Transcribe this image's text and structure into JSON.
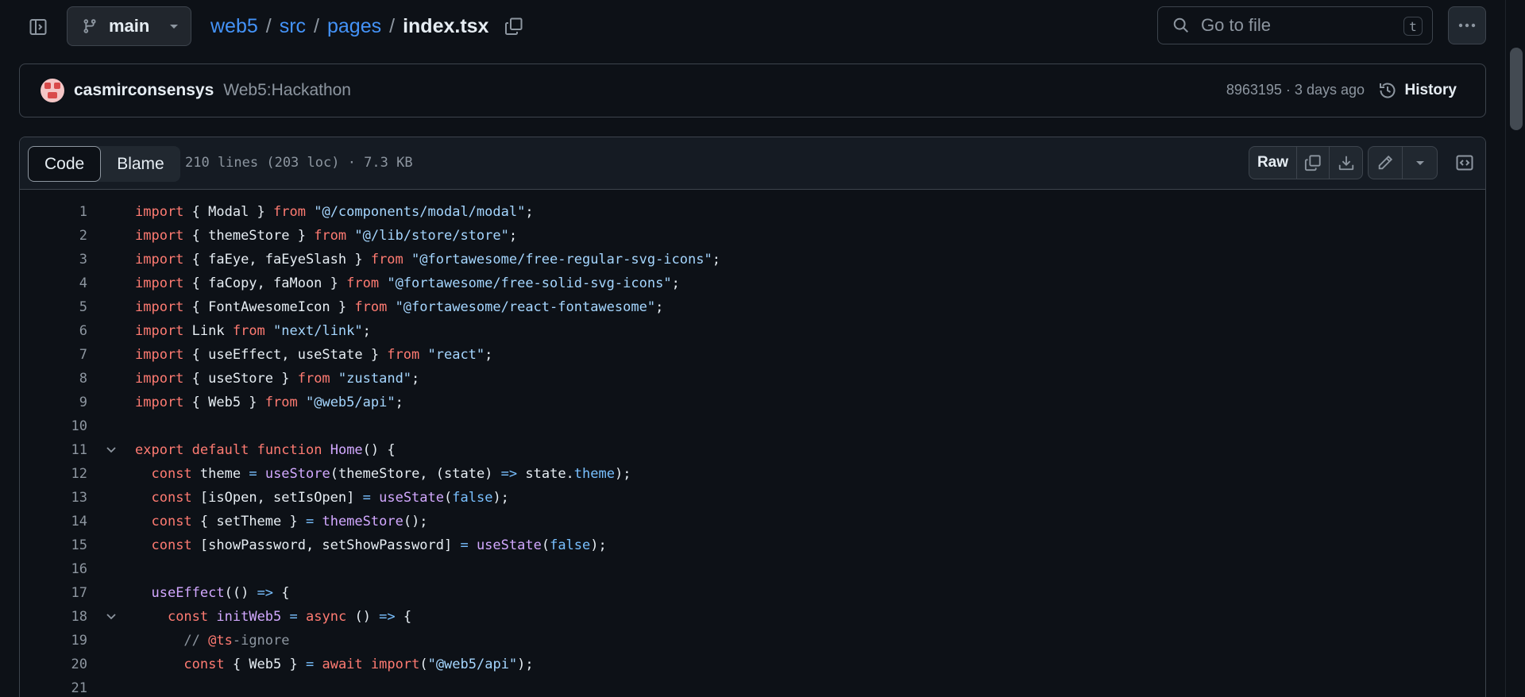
{
  "header": {
    "branch": "main",
    "breadcrumb": [
      {
        "label": "web5"
      },
      {
        "label": "src"
      },
      {
        "label": "pages"
      }
    ],
    "separator": "/",
    "current_file": "index.tsx",
    "goto_placeholder": "Go to file",
    "goto_shortcut": "t"
  },
  "commit": {
    "author": "casmirconsensys",
    "message": "Web5:Hackathon",
    "meta": "8963195 · 3 days ago",
    "history_label": "History"
  },
  "file": {
    "tabs": [
      "Code",
      "Blame"
    ],
    "active_tab": "Code",
    "info": "210 lines (203 loc) · 7.3 KB",
    "raw_label": "Raw"
  },
  "code_lines": [
    {
      "n": "1"
    },
    {
      "n": "2"
    },
    {
      "n": "3"
    },
    {
      "n": "4"
    },
    {
      "n": "5"
    },
    {
      "n": "6"
    },
    {
      "n": "7"
    },
    {
      "n": "8"
    },
    {
      "n": "9"
    },
    {
      "n": "10"
    },
    {
      "n": "11"
    },
    {
      "n": "12"
    },
    {
      "n": "13"
    },
    {
      "n": "14"
    },
    {
      "n": "15"
    },
    {
      "n": "16"
    },
    {
      "n": "17"
    },
    {
      "n": "18"
    },
    {
      "n": "19"
    },
    {
      "n": "20"
    },
    {
      "n": "21"
    }
  ],
  "code": {
    "l1": [
      [
        "kw",
        "import"
      ],
      [
        "src",
        " { Modal } "
      ],
      [
        "kw",
        "from"
      ],
      [
        "src",
        " "
      ],
      [
        "str",
        "\"@/components/modal/modal\""
      ],
      [
        "src",
        ";"
      ]
    ],
    "l2": [
      [
        "kw",
        "import"
      ],
      [
        "src",
        " { themeStore } "
      ],
      [
        "kw",
        "from"
      ],
      [
        "src",
        " "
      ],
      [
        "str",
        "\"@/lib/store/store\""
      ],
      [
        "src",
        ";"
      ]
    ],
    "l3": [
      [
        "kw",
        "import"
      ],
      [
        "src",
        " { faEye, faEyeSlash } "
      ],
      [
        "kw",
        "from"
      ],
      [
        "src",
        " "
      ],
      [
        "str",
        "\"@fortawesome/free-regular-svg-icons\""
      ],
      [
        "src",
        ";"
      ]
    ],
    "l4": [
      [
        "kw",
        "import"
      ],
      [
        "src",
        " { faCopy, faMoon } "
      ],
      [
        "kw",
        "from"
      ],
      [
        "src",
        " "
      ],
      [
        "str",
        "\"@fortawesome/free-solid-svg-icons\""
      ],
      [
        "src",
        ";"
      ]
    ],
    "l5": [
      [
        "kw",
        "import"
      ],
      [
        "src",
        " { FontAwesomeIcon } "
      ],
      [
        "kw",
        "from"
      ],
      [
        "src",
        " "
      ],
      [
        "str",
        "\"@fortawesome/react-fontawesome\""
      ],
      [
        "src",
        ";"
      ]
    ],
    "l6": [
      [
        "kw",
        "import"
      ],
      [
        "src",
        " Link "
      ],
      [
        "kw",
        "from"
      ],
      [
        "src",
        " "
      ],
      [
        "str",
        "\"next/link\""
      ],
      [
        "src",
        ";"
      ]
    ],
    "l7": [
      [
        "kw",
        "import"
      ],
      [
        "src",
        " { useEffect, useState } "
      ],
      [
        "kw",
        "from"
      ],
      [
        "src",
        " "
      ],
      [
        "str",
        "\"react\""
      ],
      [
        "src",
        ";"
      ]
    ],
    "l8": [
      [
        "kw",
        "import"
      ],
      [
        "src",
        " { useStore } "
      ],
      [
        "kw",
        "from"
      ],
      [
        "src",
        " "
      ],
      [
        "str",
        "\"zustand\""
      ],
      [
        "src",
        ";"
      ]
    ],
    "l9": [
      [
        "kw",
        "import"
      ],
      [
        "src",
        " { Web5 } "
      ],
      [
        "kw",
        "from"
      ],
      [
        "src",
        " "
      ],
      [
        "str",
        "\"@web5/api\""
      ],
      [
        "src",
        ";"
      ]
    ],
    "l10": [],
    "l11": [
      [
        "kw",
        "export"
      ],
      [
        "src",
        " "
      ],
      [
        "kw",
        "default"
      ],
      [
        "src",
        " "
      ],
      [
        "kw",
        "function"
      ],
      [
        "src",
        " "
      ],
      [
        "fn",
        "Home"
      ],
      [
        "src",
        "() {"
      ]
    ],
    "l12": [
      [
        "src",
        "  "
      ],
      [
        "kw",
        "const"
      ],
      [
        "src",
        " theme "
      ],
      [
        "cst",
        "="
      ],
      [
        "src",
        " "
      ],
      [
        "fn",
        "useStore"
      ],
      [
        "src",
        "(themeStore, (state) "
      ],
      [
        "cst",
        "=>"
      ],
      [
        "src",
        " state."
      ],
      [
        "cst",
        "theme"
      ],
      [
        "src",
        ");"
      ]
    ],
    "l13": [
      [
        "src",
        "  "
      ],
      [
        "kw",
        "const"
      ],
      [
        "src",
        " [isOpen, setIsOpen] "
      ],
      [
        "cst",
        "="
      ],
      [
        "src",
        " "
      ],
      [
        "fn",
        "useState"
      ],
      [
        "src",
        "("
      ],
      [
        "cst",
        "false"
      ],
      [
        "src",
        ");"
      ]
    ],
    "l14": [
      [
        "src",
        "  "
      ],
      [
        "kw",
        "const"
      ],
      [
        "src",
        " { setTheme } "
      ],
      [
        "cst",
        "="
      ],
      [
        "src",
        " "
      ],
      [
        "fn",
        "themeStore"
      ],
      [
        "src",
        "();"
      ]
    ],
    "l15": [
      [
        "src",
        "  "
      ],
      [
        "kw",
        "const"
      ],
      [
        "src",
        " [showPassword, setShowPassword] "
      ],
      [
        "cst",
        "="
      ],
      [
        "src",
        " "
      ],
      [
        "fn",
        "useState"
      ],
      [
        "src",
        "("
      ],
      [
        "cst",
        "false"
      ],
      [
        "src",
        ");"
      ]
    ],
    "l16": [],
    "l17": [
      [
        "src",
        "  "
      ],
      [
        "fn",
        "useEffect"
      ],
      [
        "src",
        "(() "
      ],
      [
        "cst",
        "=>"
      ],
      [
        "src",
        " {"
      ]
    ],
    "l18": [
      [
        "src",
        "    "
      ],
      [
        "kw",
        "const"
      ],
      [
        "src",
        " "
      ],
      [
        "fn",
        "initWeb5"
      ],
      [
        "src",
        " "
      ],
      [
        "cst",
        "="
      ],
      [
        "src",
        " "
      ],
      [
        "kw",
        "async"
      ],
      [
        "src",
        " () "
      ],
      [
        "cst",
        "=>"
      ],
      [
        "src",
        " {"
      ]
    ],
    "l19": [
      [
        "cmt",
        "      // "
      ],
      [
        "kw",
        "@ts"
      ],
      [
        "cmt",
        "-ignore"
      ]
    ],
    "l20": [
      [
        "src",
        "      "
      ],
      [
        "kw",
        "const"
      ],
      [
        "src",
        " { Web5 } "
      ],
      [
        "cst",
        "="
      ],
      [
        "src",
        " "
      ],
      [
        "kw",
        "await"
      ],
      [
        "src",
        " "
      ],
      [
        "kw",
        "import"
      ],
      [
        "src",
        "("
      ],
      [
        "str",
        "\"@web5/api\""
      ],
      [
        "src",
        ");"
      ]
    ],
    "l21": []
  }
}
